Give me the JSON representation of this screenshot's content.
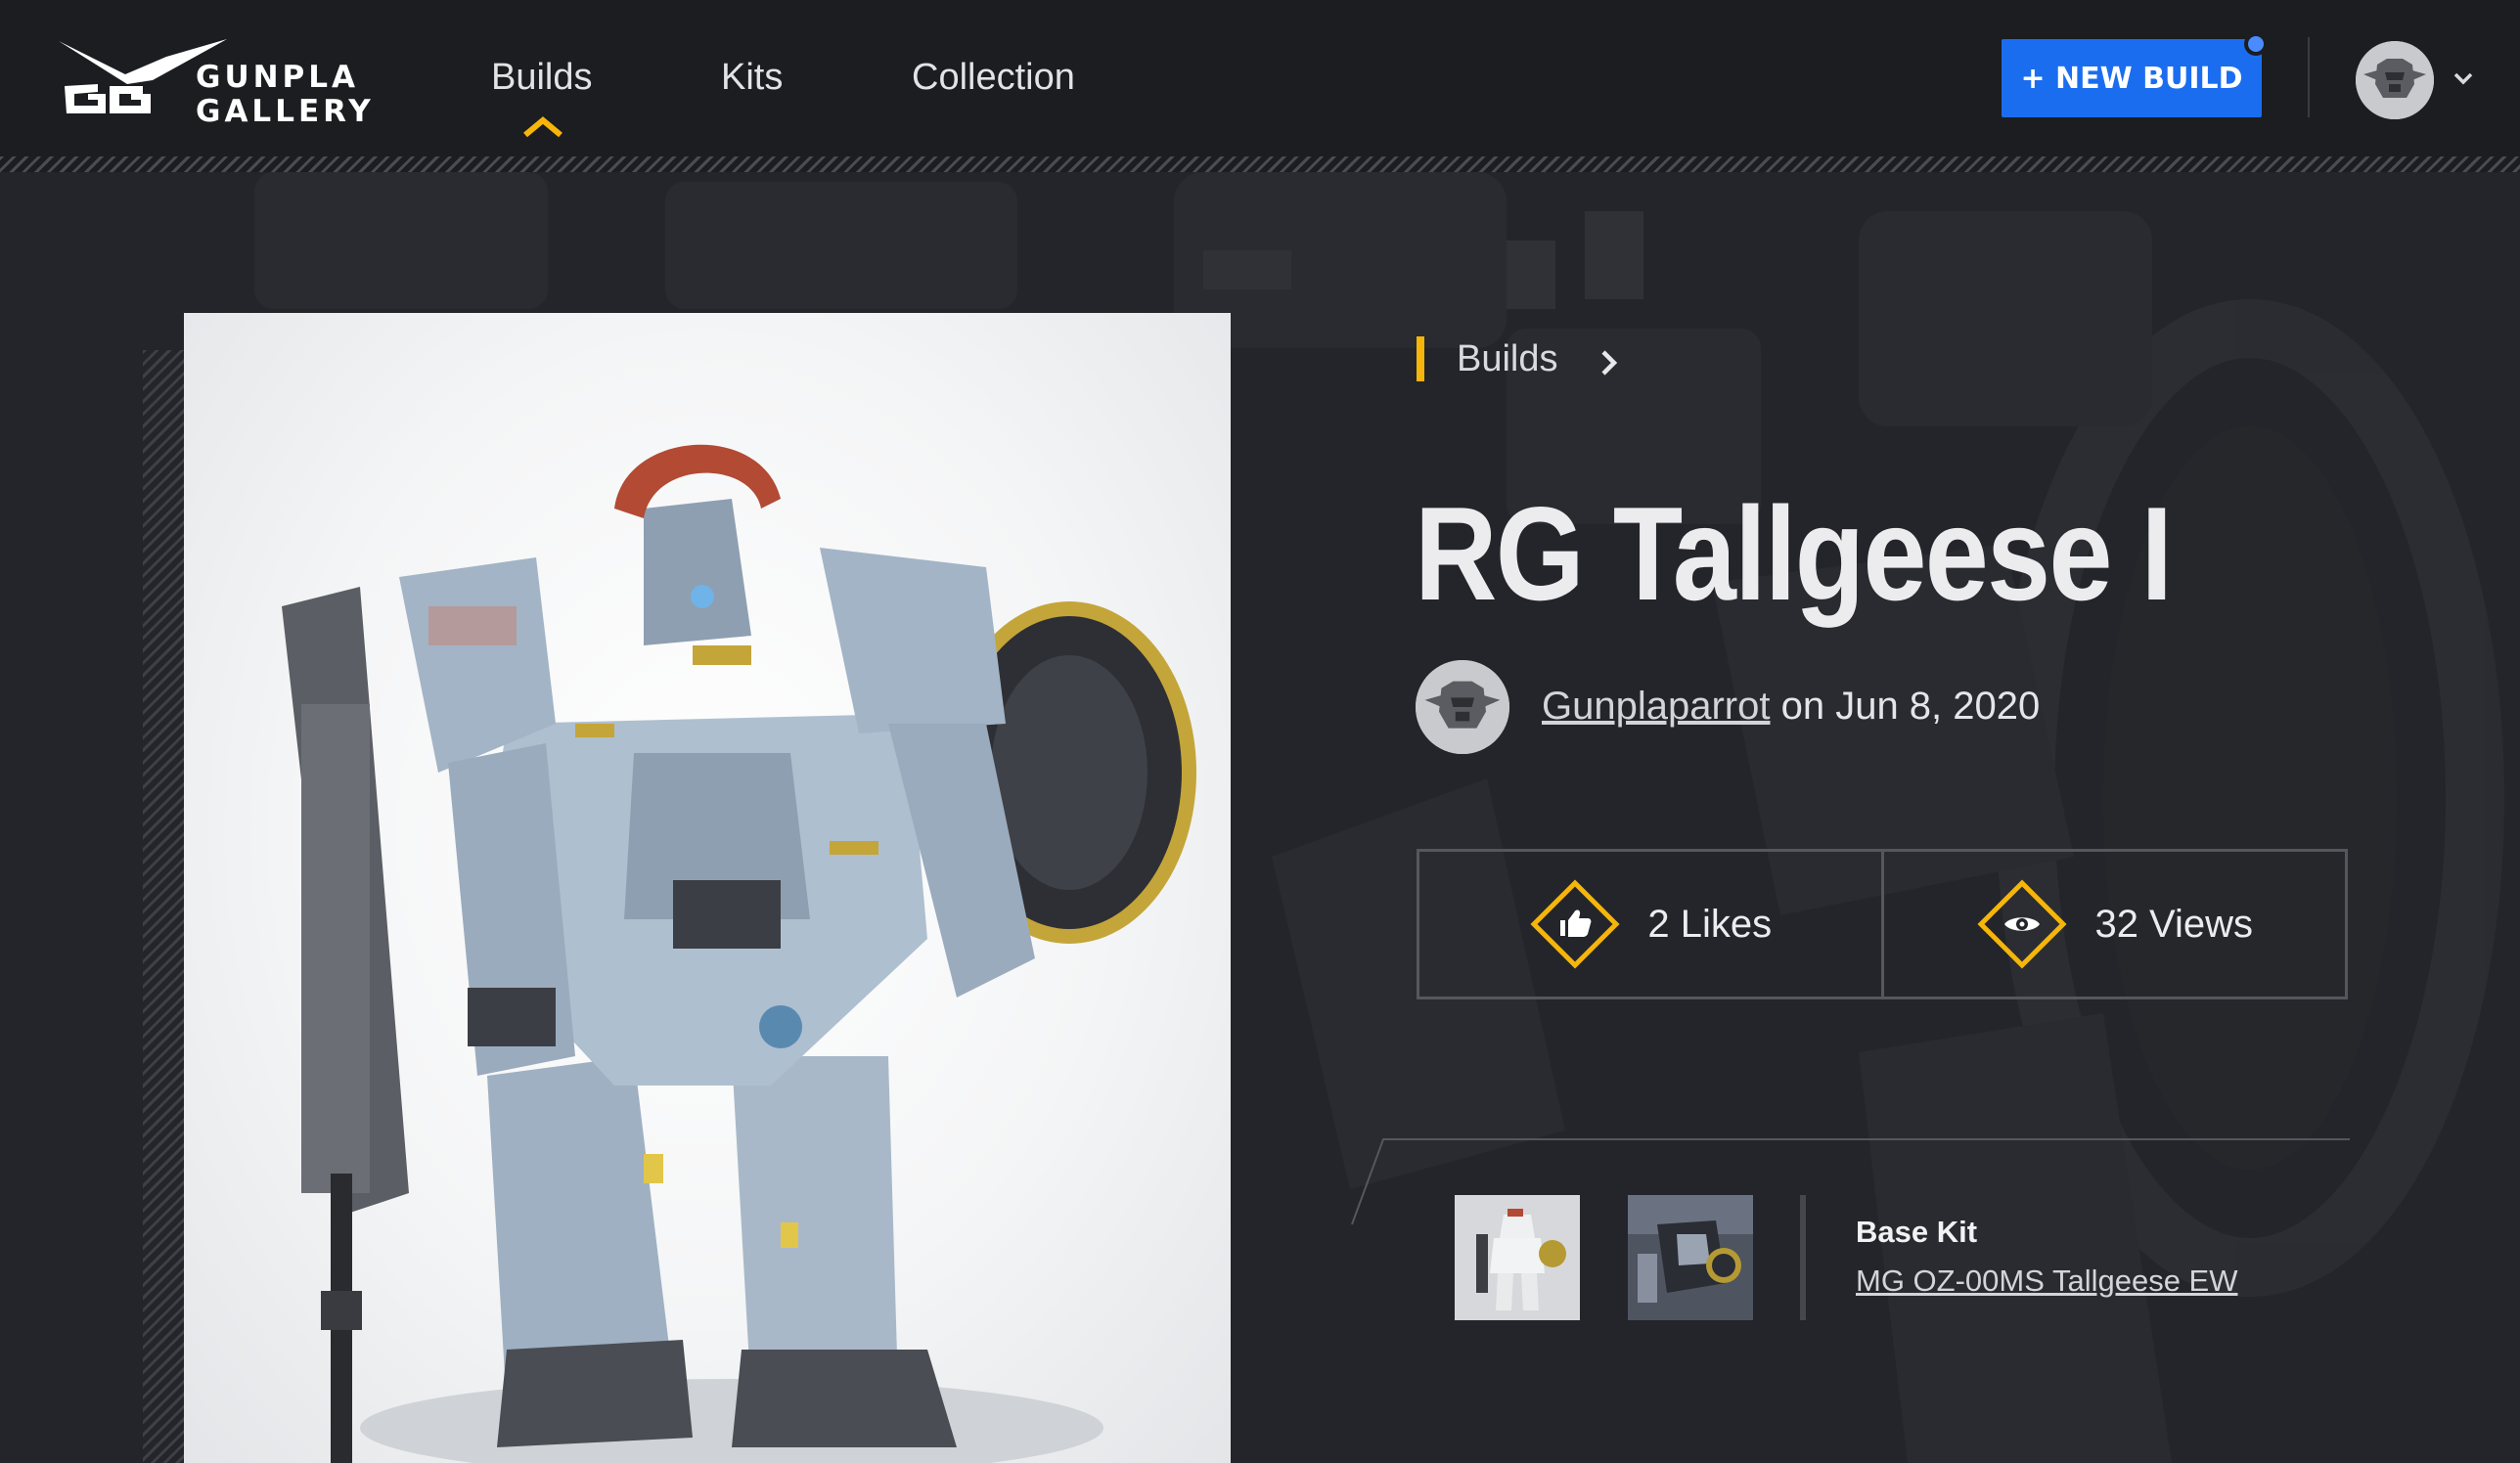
{
  "header": {
    "logo": {
      "line1": "GUNPLA",
      "line2": "GALLERY"
    },
    "nav": [
      {
        "label": "Builds",
        "active": true
      },
      {
        "label": "Kits",
        "active": false
      },
      {
        "label": "Collection",
        "active": false
      }
    ],
    "new_build_label": "+ NEW BUILD",
    "accent_color": "#f5b50a",
    "button_color": "#1b6df0"
  },
  "breadcrumb": {
    "label": "Builds"
  },
  "build": {
    "title": "RG Tallgeese I",
    "author": "Gunplaparrot",
    "date_text": " on Jun 8, 2020"
  },
  "stats": {
    "likes": "2 Likes",
    "views": "32 Views",
    "likes_icon": "thumbs-up-icon",
    "views_icon": "eye-icon"
  },
  "base_kit": {
    "label": "Base Kit",
    "name": "MG OZ-00MS Tallgeese EW"
  }
}
